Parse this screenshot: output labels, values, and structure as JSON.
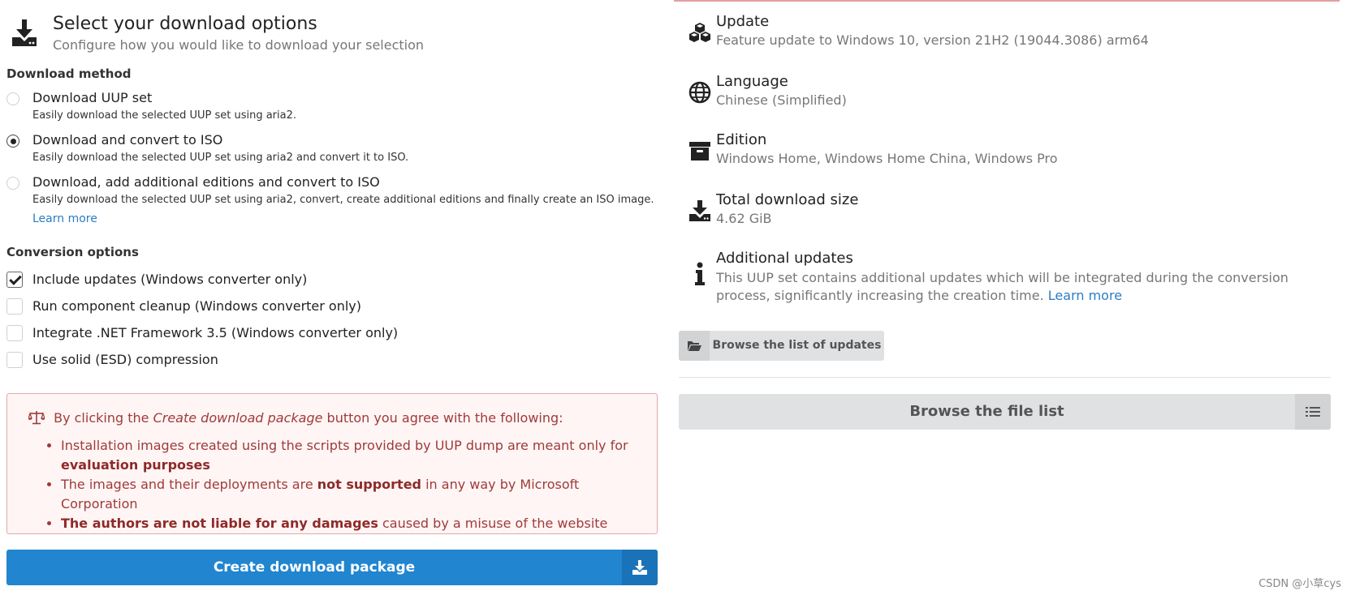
{
  "header": {
    "icon": "download-icon",
    "title": "Select your download options",
    "subtitle": "Configure how you would like to download your selection"
  },
  "download_method": {
    "label": "Download method",
    "options": [
      {
        "label": "Download UUP set",
        "desc": "Easily download the selected UUP set using aria2.",
        "checked": false
      },
      {
        "label": "Download and convert to ISO",
        "desc": "Easily download the selected UUP set using aria2 and convert it to ISO.",
        "checked": true
      },
      {
        "label": "Download, add additional editions and convert to ISO",
        "desc": "Easily download the selected UUP set using aria2, convert, create additional editions and finally create an ISO image.",
        "link": "Learn more",
        "checked": false
      }
    ]
  },
  "conversion": {
    "label": "Conversion options",
    "options": [
      {
        "label": "Include updates (Windows converter only)",
        "checked": true
      },
      {
        "label": "Run component cleanup (Windows converter only)",
        "checked": false
      },
      {
        "label": "Integrate .NET Framework 3.5 (Windows converter only)",
        "checked": false
      },
      {
        "label": "Use solid (ESD) compression",
        "checked": false
      }
    ]
  },
  "warning": {
    "icon": "balance-scale-icon",
    "head_prefix": "By clicking the",
    "head_em": "Create download package",
    "head_suffix": "button you agree with the following:",
    "items": [
      {
        "before": "Installation images created using the scripts provided by UUP dump are meant only for ",
        "bold": "evaluation purposes",
        "after": ""
      },
      {
        "before": "The images and their deployments are ",
        "bold": "not supported",
        "after": " in any way by Microsoft Corporation"
      },
      {
        "before": "",
        "bold": "The authors are not liable for any damages",
        "after": " caused by a misuse of the website"
      }
    ]
  },
  "create_button": {
    "label": "Create download package",
    "icon": "download-icon"
  },
  "info": {
    "update": {
      "icon": "cubes-icon",
      "title": "Update",
      "value": "Feature update to Windows 10, version 21H2 (19044.3086) arm64"
    },
    "language": {
      "icon": "globe-icon",
      "title": "Language",
      "value": "Chinese (Simplified)"
    },
    "edition": {
      "icon": "archive-icon",
      "title": "Edition",
      "value": "Windows Home, Windows Home China, Windows Pro"
    },
    "size": {
      "icon": "download-icon",
      "title": "Total download size",
      "value": "4.62 GiB"
    },
    "additional": {
      "icon": "info-icon",
      "title": "Additional updates",
      "text": "This UUP set contains additional updates which will be integrated during the conversion process, significantly increasing the creation time.",
      "link": "Learn more"
    }
  },
  "browse_updates_button": {
    "label": "Browse the list of updates",
    "icon": "folder-open-icon"
  },
  "browse_files_button": {
    "label": "Browse the file list",
    "icon": "list-icon"
  },
  "watermark": "CSDN @小草cys",
  "colors": {
    "primary": "#2185d0",
    "warning_bg": "#fff5f5",
    "warning_text": "#9f3a38",
    "link": "#2b7dc4"
  }
}
